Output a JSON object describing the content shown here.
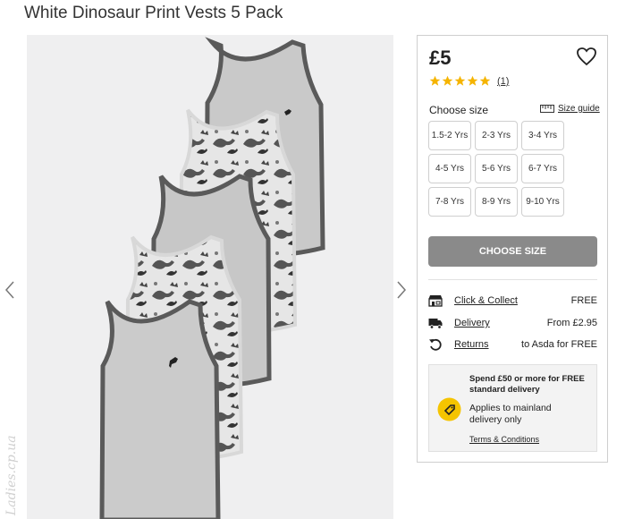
{
  "product": {
    "title": "White Dinosaur Print Vests 5 Pack",
    "price": "£5",
    "rating_stars": 5,
    "rating_count": "(1)"
  },
  "gallery": {
    "prev_icon": "chevron-left-icon",
    "next_icon": "chevron-right-icon",
    "watermark": "Ladies.cp.ua"
  },
  "size_section": {
    "label": "Choose size",
    "guide_label": "Size guide",
    "sizes": [
      "1.5-2 Yrs",
      "2-3 Yrs",
      "3-4 Yrs",
      "4-5 Yrs",
      "5-6 Yrs",
      "6-7 Yrs",
      "7-8 Yrs",
      "8-9 Yrs",
      "9-10 Yrs"
    ],
    "button_label": "CHOOSE SIZE"
  },
  "delivery": [
    {
      "icon": "store-icon",
      "label": "Click & Collect",
      "value": "FREE"
    },
    {
      "icon": "truck-icon",
      "label": "Delivery",
      "value": "From £2.95"
    },
    {
      "icon": "return-icon",
      "label": "Returns",
      "value": "to Asda for FREE"
    }
  ],
  "promo": {
    "heading": "Spend £50 or more for FREE standard delivery",
    "text": "Applies to mainland delivery only",
    "terms": "Terms & Conditions",
    "badge_color": "#f5c400"
  },
  "colors": {
    "button_disabled": "#8a8a8a",
    "star": "#f5b400"
  }
}
